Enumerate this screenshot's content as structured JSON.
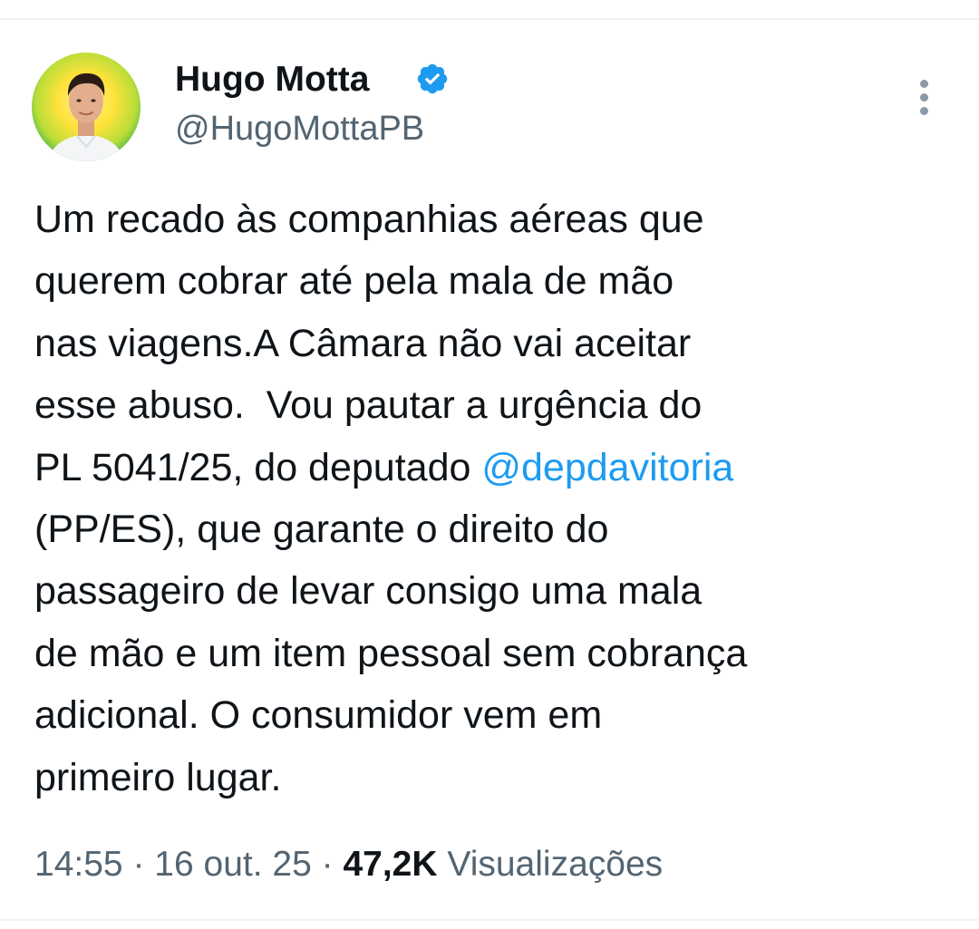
{
  "author": {
    "name": "Hugo Motta",
    "handle": "@HugoMottaPB",
    "verified": true,
    "verified_color": "#1d9bf0",
    "avatar_icon": "profile-photo",
    "more_icon": "vertical-ellipsis-icon"
  },
  "tweet": {
    "lines": [
      {
        "text": "Um recado às companhias aéreas que"
      },
      {
        "text": "querem cobrar até pela mala de mão"
      },
      {
        "text": "nas viagens.A Câmara não vai aceitar"
      },
      {
        "text": "esse abuso.  Vou pautar a urgência do"
      },
      {
        "text": "PL 5041/25, do deputado ",
        "mention": "@depdavitoria"
      },
      {
        "text": "(PP/ES), que garante o direito do"
      },
      {
        "text": "passageiro de levar consigo uma mala"
      },
      {
        "text": "de mão e um item pessoal sem cobrança"
      },
      {
        "text": "adicional. O consumidor vem em"
      },
      {
        "text": "primeiro lugar."
      }
    ],
    "mention_color": "#1d9bf0"
  },
  "meta": {
    "time": "14:55",
    "separator": "·",
    "date": "16 out. 25",
    "views_count": "47,2K",
    "views_label": "Visualizações"
  },
  "colors": {
    "text_primary": "#0f1419",
    "text_secondary": "#536471",
    "accent": "#1d9bf0"
  }
}
